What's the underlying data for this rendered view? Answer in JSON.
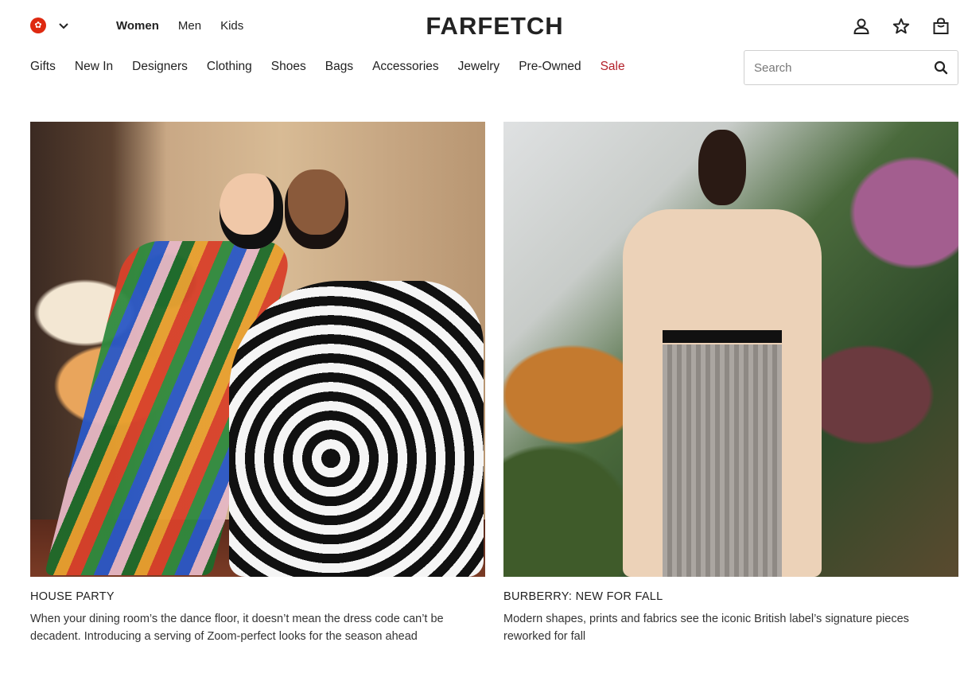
{
  "header": {
    "region": {
      "flag_icon": "hong-kong-flag-icon",
      "dropdown_icon": "chevron-down-icon"
    },
    "gender_tabs": [
      {
        "label": "Women",
        "active": true
      },
      {
        "label": "Men",
        "active": false
      },
      {
        "label": "Kids",
        "active": false
      }
    ],
    "logo": "FARFETCH",
    "actions": [
      {
        "icon": "account-icon"
      },
      {
        "icon": "wishlist-star-icon"
      },
      {
        "icon": "shopping-bag-icon"
      }
    ]
  },
  "nav": {
    "categories": [
      "Gifts",
      "New In",
      "Designers",
      "Clothing",
      "Shoes",
      "Bags",
      "Accessories",
      "Jewelry",
      "Pre-Owned",
      "Sale"
    ],
    "sale_color": "#b3202a"
  },
  "search": {
    "placeholder": "Search",
    "value": "",
    "icon": "search-icon"
  },
  "cards": [
    {
      "image": "house-party-editorial-image",
      "title": "HOUSE PARTY",
      "description": "When your dining room’s the dance floor, it doesn’t mean the dress code can’t be decadent. Introducing a serving of Zoom-perfect looks for the season ahead"
    },
    {
      "image": "burberry-new-for-fall-editorial-image",
      "title": "BURBERRY: NEW FOR FALL",
      "description": "Modern shapes, prints and fabrics see the iconic British label’s signature pieces reworked for fall"
    }
  ]
}
